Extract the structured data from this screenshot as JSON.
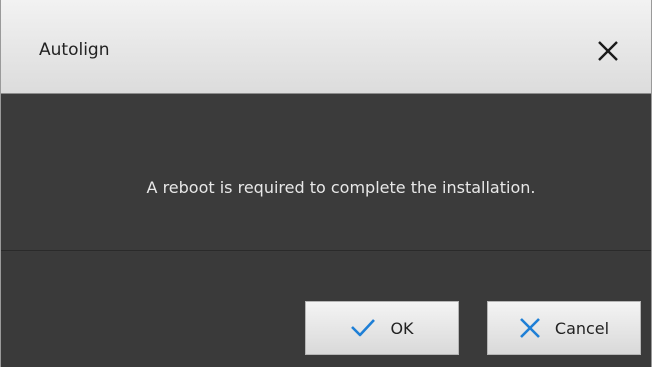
{
  "dialog": {
    "title": "Autolign",
    "message": "A reboot is required to complete the installation.",
    "buttons": {
      "ok_label": "OK",
      "cancel_label": "Cancel"
    }
  },
  "icons": {
    "close": "close-icon",
    "ok": "checkmark-icon",
    "cancel": "cross-icon"
  },
  "colors": {
    "titlebar": "#e6e6e6",
    "body": "#3b3b3b",
    "accent_blue": "#1e7fd6",
    "message_text": "#e8e8e8"
  }
}
